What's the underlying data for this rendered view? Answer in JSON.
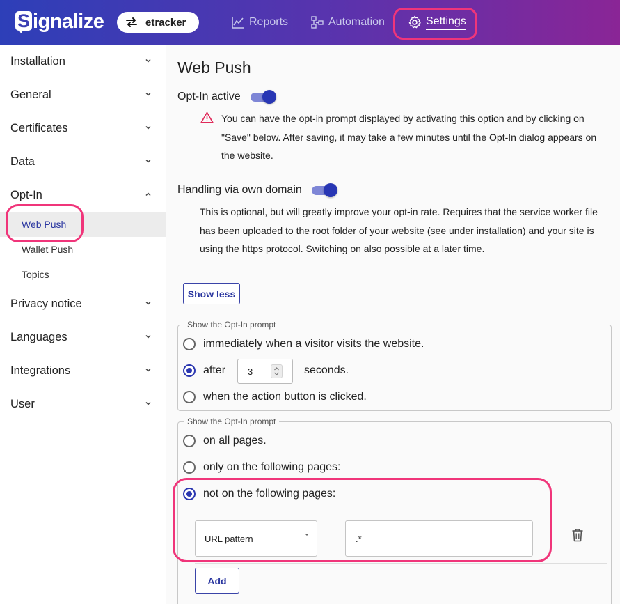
{
  "header": {
    "logo_text": "ignalize",
    "logo_letter": "S",
    "account": "etracker",
    "nav": {
      "reports": "Reports",
      "automation": "Automation",
      "settings": "Settings"
    }
  },
  "sidebar": {
    "items": [
      {
        "label": "Installation",
        "expanded": false
      },
      {
        "label": "General",
        "expanded": false
      },
      {
        "label": "Certificates",
        "expanded": false
      },
      {
        "label": "Data",
        "expanded": false
      },
      {
        "label": "Opt-In",
        "expanded": true
      },
      {
        "label": "Privacy notice",
        "expanded": false
      },
      {
        "label": "Languages",
        "expanded": false
      },
      {
        "label": "Integrations",
        "expanded": false
      },
      {
        "label": "User",
        "expanded": false
      }
    ],
    "optin_sub": [
      {
        "label": "Web Push",
        "active": true
      },
      {
        "label": "Wallet Push",
        "active": false
      },
      {
        "label": "Topics",
        "active": false
      }
    ]
  },
  "main": {
    "title": "Web Push",
    "optin_active": {
      "label": "Opt-In active",
      "enabled": true,
      "note": "You can have the opt-in prompt displayed by activating this option and by clicking on \"Save\" below.  After saving, it may take a few minutes until the Opt-In dialog appears on the website."
    },
    "own_domain": {
      "label": "Handling via own domain",
      "enabled": true,
      "note": "This is optional, but will greatly improve your opt-in rate. Requires that the service worker file has been uploaded to the root folder of your website (see under installation) and your site is using the https protocol. Switching on also possible at a later time."
    },
    "show_less": "Show less",
    "timing": {
      "legend": "Show the Opt-In prompt",
      "options": [
        "immediately when a visitor visits the website.",
        "after",
        "when the action button is clicked."
      ],
      "selected_index": 1,
      "seconds_value": "3",
      "seconds_label": "seconds."
    },
    "pages": {
      "legend": "Show the Opt-In prompt",
      "options": [
        "on all pages.",
        "only on the following pages:",
        "not on the following pages:"
      ],
      "selected_index": 2,
      "rule": {
        "type": "URL pattern",
        "value": ".*"
      },
      "add_label": "Add"
    }
  },
  "colors": {
    "accent": "#2a36b0",
    "highlight": "#f0357a",
    "header_start": "#2d3fb8",
    "header_end": "#8a2596"
  }
}
